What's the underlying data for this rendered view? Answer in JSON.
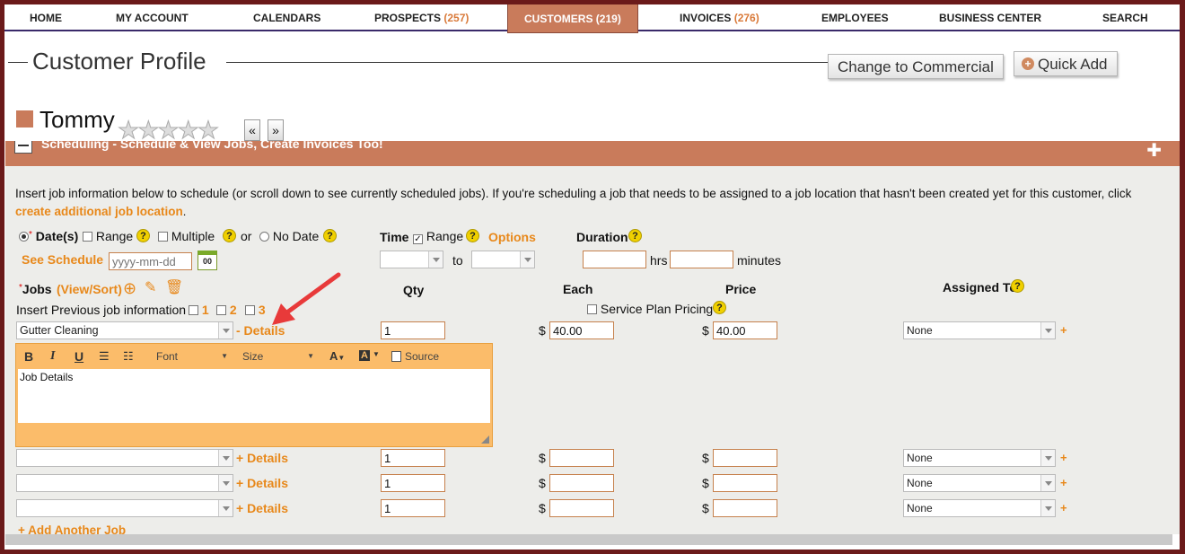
{
  "nav": {
    "home": "HOME",
    "my_account": "MY ACCOUNT",
    "calendars": "CALENDARS",
    "prospects": "PROSPECTS",
    "prospects_count": "(257)",
    "customers": "CUSTOMERS",
    "customers_count": "(219)",
    "invoices": "INVOICES",
    "invoices_count": "(276)",
    "employees": "EMPLOYEES",
    "business_center": "BUSINESS CENTER",
    "search": "SEARCH"
  },
  "header": {
    "title": "Customer Profile",
    "change_button": "Change to Commercial",
    "quick_add_button": "Quick Add"
  },
  "customer": {
    "name": "Tommy",
    "stars": "★★★★★",
    "prev": "«",
    "next": "»"
  },
  "section": {
    "title": "Scheduling - Schedule & View Jobs, Create Invoices Too!"
  },
  "intro": {
    "text": "Insert job information below to schedule (or scroll down to see currently scheduled jobs). If you're scheduling a job that needs to be assigned to a job location that hasn't been created yet for this customer, click",
    "link": "create additional job location",
    "period": "."
  },
  "dates": {
    "dates_label": "Date(s)",
    "range_label": "Range",
    "multiple_label": "Multiple",
    "or": "or",
    "no_date_label": "No Date",
    "see_schedule": "See Schedule",
    "date_placeholder": "yyyy-mm-dd",
    "calendar_num": "00"
  },
  "time": {
    "label": "Time",
    "range_label": "Range",
    "options": "Options",
    "to": "to"
  },
  "duration": {
    "label": "Duration",
    "hrs": "hrs",
    "minutes": "minutes"
  },
  "jobs": {
    "label": "Jobs",
    "view_sort": "(View/Sort)",
    "insert_previous": "Insert Previous job information",
    "prev1": "1",
    "prev2": "2",
    "prev3": "3",
    "qty_header": "Qty",
    "each_header": "Each",
    "price_header": "Price",
    "assigned_header": "Assigned To",
    "service_plan": "Service Plan Pricing",
    "add_another": "+ Add Another Job",
    "currency": "$",
    "plus": "+",
    "rows": [
      {
        "job": "Gutter Cleaning",
        "details": "- Details",
        "qty": "1",
        "each": "40.00",
        "price": "40.00",
        "assigned": "None"
      },
      {
        "job": "",
        "details": "+ Details",
        "qty": "1",
        "each": "",
        "price": "",
        "assigned": "None"
      },
      {
        "job": "",
        "details": "+ Details",
        "qty": "1",
        "each": "",
        "price": "",
        "assigned": "None"
      },
      {
        "job": "",
        "details": "+ Details",
        "qty": "1",
        "each": "",
        "price": "",
        "assigned": "None"
      }
    ]
  },
  "editor": {
    "bold": "B",
    "italic": "I",
    "underline": "U",
    "font": "Font",
    "size": "Size",
    "source": "Source",
    "content": "Job Details"
  },
  "colors": {
    "accent": "#c97b5b",
    "link_orange": "#e8881a",
    "frame": "#6b1a1a",
    "help_yellow": "#f0d000"
  }
}
